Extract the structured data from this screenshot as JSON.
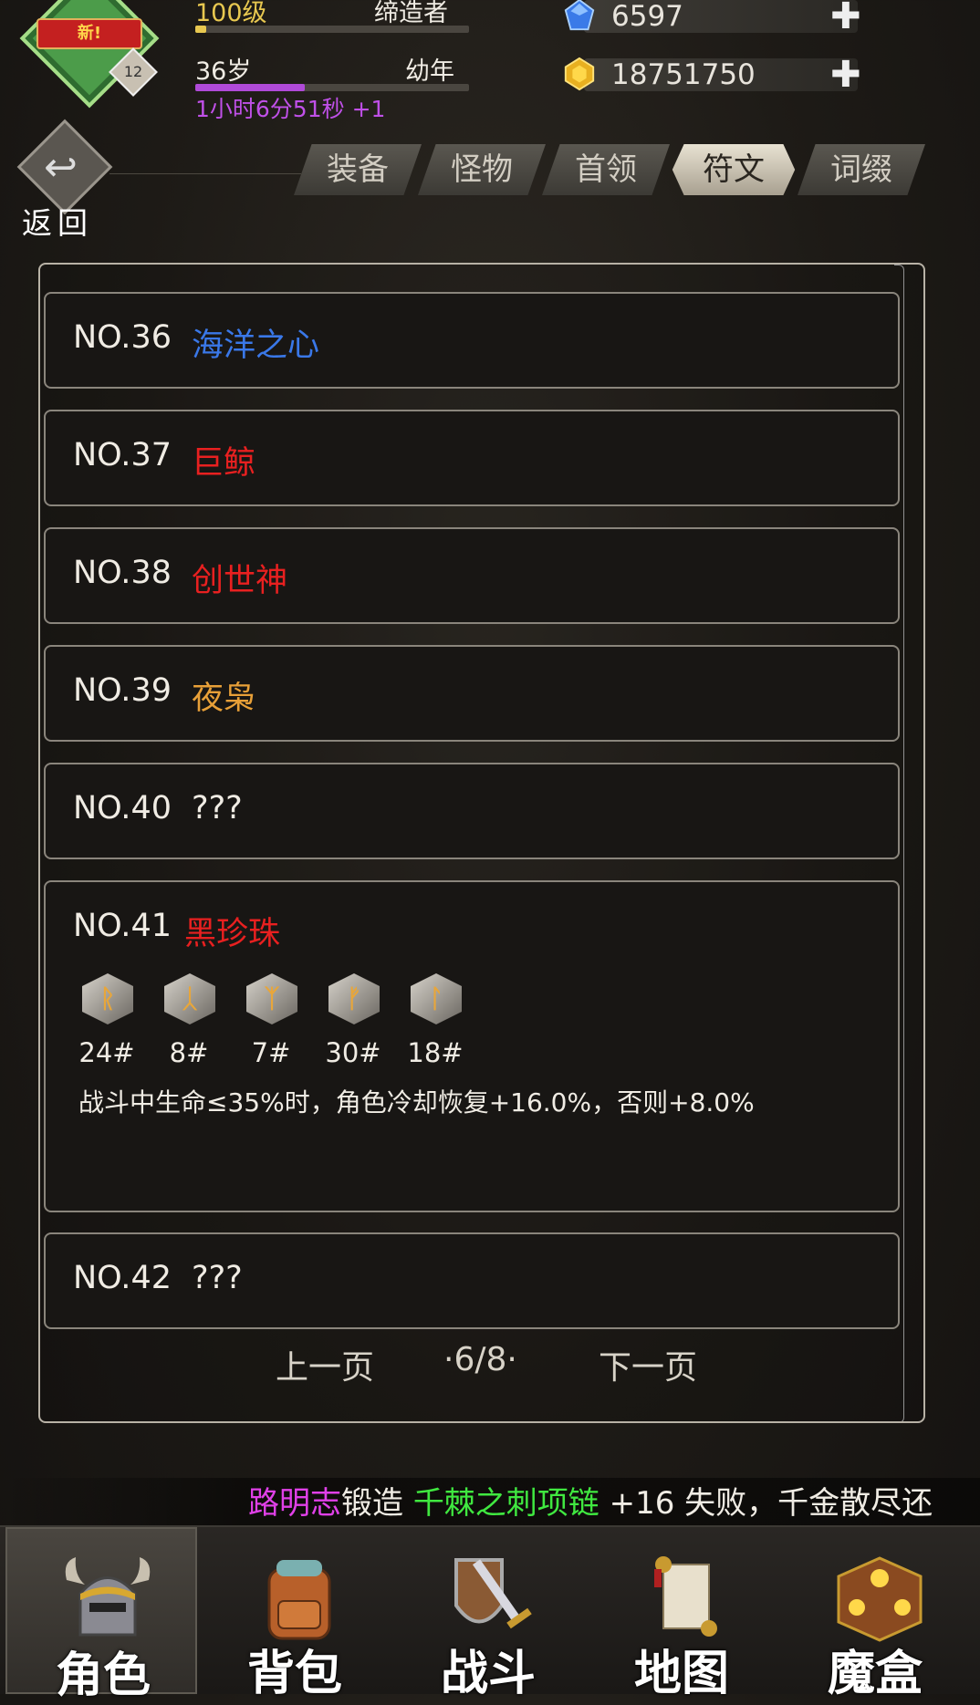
{
  "header": {
    "badge_label": "新!",
    "badge_level": "12",
    "level_label": "100级",
    "title_label": "缔造者",
    "age_label": "36岁",
    "stage_label": "幼年",
    "timer_label": "1小时6分51秒 +1",
    "age_progress": 0.4,
    "gems": "6597",
    "gold": "18751750"
  },
  "back": {
    "label": "返回"
  },
  "tabs": [
    {
      "label": "装备",
      "active": false
    },
    {
      "label": "怪物",
      "active": false
    },
    {
      "label": "首领",
      "active": false
    },
    {
      "label": "符文",
      "active": true
    },
    {
      "label": "词缀",
      "active": false
    }
  ],
  "entries": [
    {
      "no": "NO.36",
      "name": "海洋之心",
      "color": "#3a78e8"
    },
    {
      "no": "NO.37",
      "name": "巨鲸",
      "color": "#e82020"
    },
    {
      "no": "NO.38",
      "name": "创世神",
      "color": "#e82020"
    },
    {
      "no": "NO.39",
      "name": "夜枭",
      "color": "#e8a038"
    },
    {
      "no": "NO.40",
      "name": "???",
      "color": "#f0ece4"
    },
    {
      "no": "NO.41",
      "name": "黑珍珠",
      "color": "#e82020",
      "runes": [
        "24#",
        "8#",
        "7#",
        "30#",
        "18#"
      ],
      "desc": "战斗中生命≤35%时，角色冷却恢复+16.0%，否则+8.0%"
    },
    {
      "no": "NO.42",
      "name": "???",
      "color": "#f0ece4"
    }
  ],
  "pager": {
    "prev": "上一页",
    "page": "·6/8·",
    "next": "下一页"
  },
  "ticker": {
    "player": "路明志",
    "action": "锻造",
    "item": "千棘之刺项链",
    "rest": " +16 失败，千金散尽还"
  },
  "nav": [
    {
      "label": "角色",
      "icon": "helmet-icon",
      "active": true
    },
    {
      "label": "背包",
      "icon": "backpack-icon",
      "active": false
    },
    {
      "label": "战斗",
      "icon": "sword-shield-icon",
      "active": false
    },
    {
      "label": "地图",
      "icon": "scroll-map-icon",
      "active": false
    },
    {
      "label": "魔盒",
      "icon": "magic-box-icon",
      "active": false
    }
  ]
}
